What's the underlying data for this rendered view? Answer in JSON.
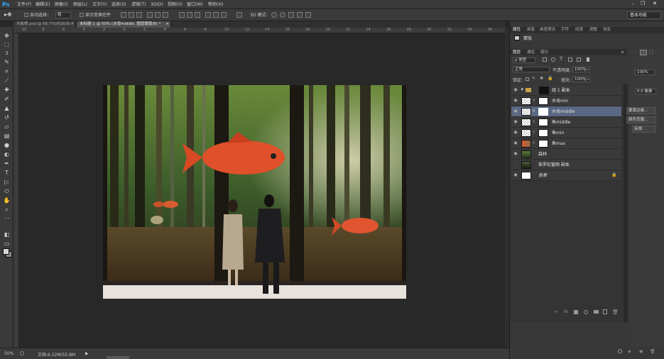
{
  "app": {
    "logo": "Ps"
  },
  "menu": [
    "文件(F)",
    "编辑(E)",
    "图像(I)",
    "图层(L)",
    "文字(Y)",
    "选择(S)",
    "滤镜(T)",
    "3D(D)",
    "视图(V)",
    "窗口(W)",
    "帮助(H)"
  ],
  "window_controls": {
    "minimize": "–",
    "restore": "❐",
    "close": "✕"
  },
  "options": {
    "auto_select_label": "自动选择：",
    "auto_select_value": "组",
    "show_transform_label": "显示变换控件",
    "mode_3d_label": "3D 模式：",
    "workspace": "基本功能"
  },
  "tabs": [
    {
      "label": "木板嗯.psd @ 66.7%(RGB/8) *",
      "close": "×"
    },
    {
      "label": "未标题-1 @ 50% (水母middle, 图层蒙版/8) *",
      "close": "×"
    }
  ],
  "ruler_ticks": [
    "10",
    "8",
    "6",
    "4",
    "2",
    "0",
    "2",
    "4",
    "6",
    "8",
    "10",
    "12",
    "14",
    "16",
    "18",
    "20",
    "22",
    "24",
    "26",
    "28",
    "30",
    "32",
    "34",
    "36"
  ],
  "status": {
    "zoom": "50%",
    "doc_info": "文档:6.22M/55.8M"
  },
  "top_panel": {
    "tabs": [
      "属性",
      "画笔",
      "画笔预设",
      "字符",
      "段落",
      "调整",
      "信息"
    ],
    "item": "蒙版"
  },
  "layers_panel": {
    "tabs": [
      "图层",
      "通道",
      "路径"
    ],
    "kind_filter": "ρ 类型",
    "blend_mode": "正常",
    "opacity_label": "不透明度:",
    "opacity_value": "100%",
    "lock_label": "锁定:",
    "fill_label": "填充:",
    "fill_value": "100%",
    "layers": [
      {
        "name": "组 1 副本",
        "type": "group",
        "visible": true,
        "selected": false
      },
      {
        "name": "水母min",
        "type": "masked",
        "visible": true,
        "selected": false
      },
      {
        "name": "水母middle",
        "type": "masked",
        "visible": true,
        "selected": true
      },
      {
        "name": "鱼middle",
        "type": "masked",
        "visible": true,
        "selected": false
      },
      {
        "name": "鱼min",
        "type": "masked",
        "visible": true,
        "selected": false
      },
      {
        "name": "鱼max",
        "type": "masked-photo",
        "visible": true,
        "selected": false
      },
      {
        "name": "森林",
        "type": "photo",
        "visible": true,
        "selected": false
      },
      {
        "name": "侏罗纪窗图 副本",
        "type": "photo",
        "visible": false,
        "selected": false
      },
      {
        "name": "背景",
        "type": "background",
        "visible": true,
        "selected": false,
        "locked": true
      }
    ]
  },
  "properties_side": {
    "density": "100%",
    "feather": "0.0 像素",
    "mask_edge": "蒙版边缘...",
    "color_range": "颜色范围...",
    "invert": "反相"
  },
  "colors": {
    "accent": "#31a8ff",
    "selected_layer": "#5a6782"
  }
}
